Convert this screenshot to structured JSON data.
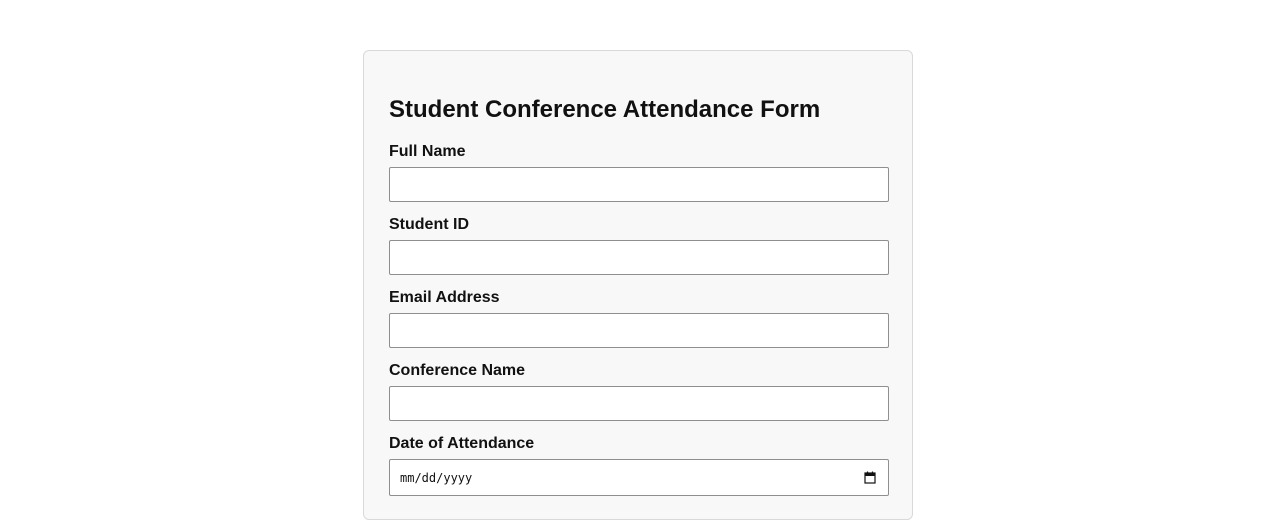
{
  "form": {
    "title": "Student Conference Attendance Form",
    "fields": [
      {
        "label": "Full Name",
        "value": ""
      },
      {
        "label": "Student ID",
        "value": ""
      },
      {
        "label": "Email Address",
        "value": ""
      },
      {
        "label": "Conference Name",
        "value": ""
      },
      {
        "label": "Date of Attendance",
        "value": "",
        "placeholder": "mm/dd/yyyy",
        "icon": "calendar-icon"
      }
    ]
  }
}
